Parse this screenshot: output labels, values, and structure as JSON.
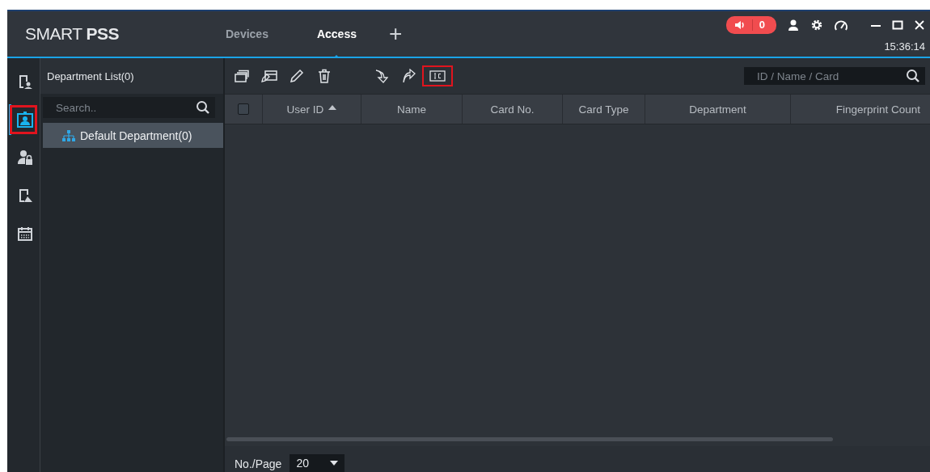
{
  "app": {
    "logo_light": "SMART ",
    "logo_bold": "PSS"
  },
  "tabs": [
    {
      "label": "Devices",
      "selected": false
    },
    {
      "label": "Access",
      "selected": true
    }
  ],
  "add_tab": "+",
  "alarm": {
    "count": "0"
  },
  "clock": "15:36:14",
  "nav": [
    {
      "kind": "door",
      "selected": false
    },
    {
      "kind": "person-card",
      "selected": true,
      "highlighted": true
    },
    {
      "kind": "person-lock",
      "selected": false
    },
    {
      "kind": "report",
      "selected": false
    },
    {
      "kind": "calendar",
      "selected": false
    }
  ],
  "department": {
    "title": "Department List(0)",
    "search_placeholder": "Search..",
    "items": [
      {
        "label": "Default Department(0)",
        "selected": true
      }
    ]
  },
  "toolbar": [
    {
      "kind": "cards"
    },
    {
      "kind": "card-edit"
    },
    {
      "kind": "pencil"
    },
    {
      "kind": "trash"
    },
    {
      "kind": "import"
    },
    {
      "kind": "export"
    },
    {
      "kind": "ic",
      "highlighted": true
    }
  ],
  "user_search": {
    "placeholder": "ID / Name / Card"
  },
  "table": {
    "select_all": {
      "checked": false
    },
    "columns": [
      {
        "label": "User ID",
        "sorted": true
      },
      {
        "label": "Name",
        "sorted": false
      },
      {
        "label": "Card No.",
        "sorted": false
      },
      {
        "label": "Card Type",
        "sorted": false
      },
      {
        "label": "Department",
        "sorted": false
      },
      {
        "label": "Fingerprint Count",
        "sorted": false
      }
    ]
  },
  "pager": {
    "label": "No./Page",
    "page_size": "20"
  }
}
